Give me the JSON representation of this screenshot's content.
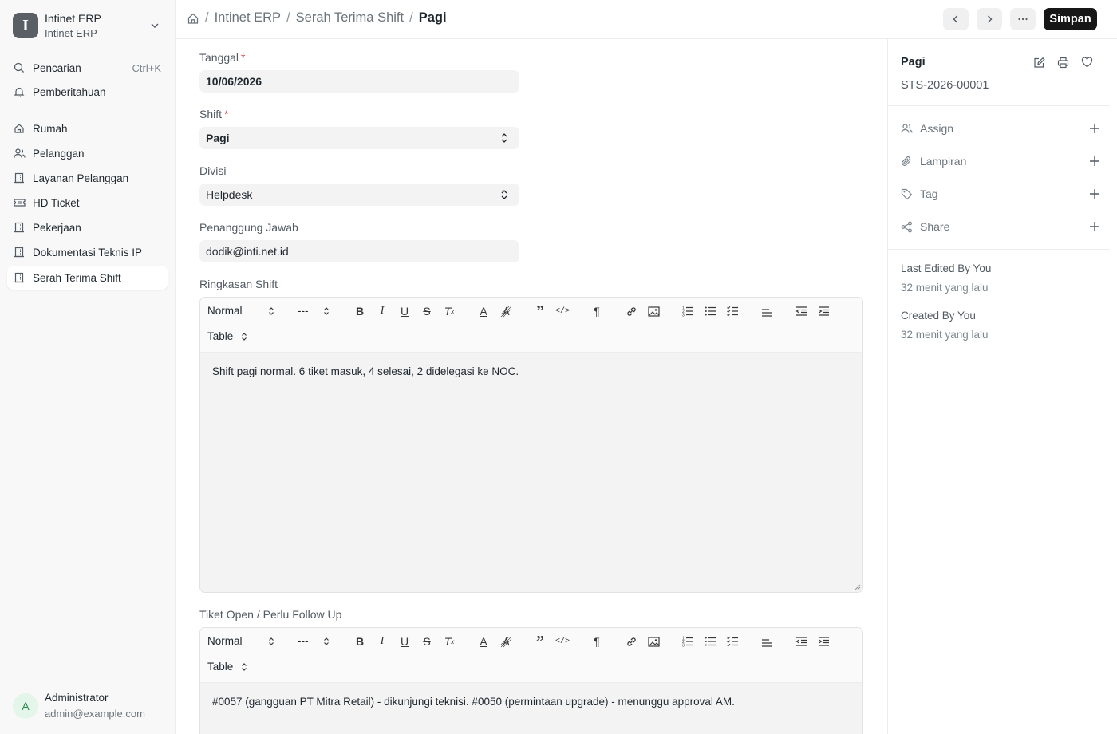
{
  "app": {
    "name": "Intinet ERP",
    "subtitle": "Intinet ERP"
  },
  "sidebar": {
    "search": {
      "label": "Pencarian",
      "shortcut": "Ctrl+K"
    },
    "notifications": {
      "label": "Pemberitahuan"
    },
    "items": [
      {
        "label": "Rumah",
        "icon": "home-icon"
      },
      {
        "label": "Pelanggan",
        "icon": "users-icon"
      },
      {
        "label": "Layanan Pelanggan",
        "icon": "building-icon"
      },
      {
        "label": "HD Ticket",
        "icon": "ticket-icon"
      },
      {
        "label": "Pekerjaan",
        "icon": "building-icon"
      },
      {
        "label": "Dokumentasi Teknis IP",
        "icon": "building-icon"
      },
      {
        "label": "Serah Terima Shift",
        "icon": "building-icon",
        "active": true
      }
    ],
    "user": {
      "initial": "A",
      "name": "Administrator",
      "email": "admin@example.com"
    }
  },
  "header": {
    "breadcrumb": [
      "Intinet ERP",
      "Serah Terima Shift",
      "Pagi"
    ],
    "save_label": "Simpan"
  },
  "form": {
    "tanggal": {
      "label": "Tanggal",
      "value": "10/06/2026"
    },
    "shift": {
      "label": "Shift",
      "value": "Pagi"
    },
    "divisi": {
      "label": "Divisi",
      "value": "Helpdesk"
    },
    "penanggung_jawab": {
      "label": "Penanggung Jawab",
      "value": "dodik@inti.net.id"
    },
    "ringkasan": {
      "label": "Ringkasan Shift",
      "toolbar": {
        "style": "Normal",
        "size": "---",
        "table": "Table"
      },
      "content": "Shift pagi normal. 6 tiket masuk, 4 selesai, 2 didelegasi ke NOC."
    },
    "tiket_open": {
      "label": "Tiket Open / Perlu Follow Up",
      "toolbar": {
        "style": "Normal",
        "size": "---",
        "table": "Table"
      },
      "content": "#0057 (gangguan PT Mitra Retail) - dikunjungi teknisi. #0050 (permintaan upgrade) - menunggu approval AM."
    }
  },
  "right_panel": {
    "title": "Pagi",
    "doc_id": "STS-2026-00001",
    "actions": [
      {
        "label": "Assign",
        "icon": "user-icon"
      },
      {
        "label": "Lampiran",
        "icon": "paperclip-icon"
      },
      {
        "label": "Tag",
        "icon": "tag-icon"
      },
      {
        "label": "Share",
        "icon": "share-icon"
      }
    ],
    "last_edited": {
      "label": "Last Edited By You",
      "time": "32 menit yang lalu"
    },
    "created": {
      "label": "Created By You",
      "time": "32 menit yang lalu"
    }
  },
  "colors": {
    "primary_button": "#171717",
    "required": "#e0474f",
    "field_bg": "#f3f3f3"
  }
}
